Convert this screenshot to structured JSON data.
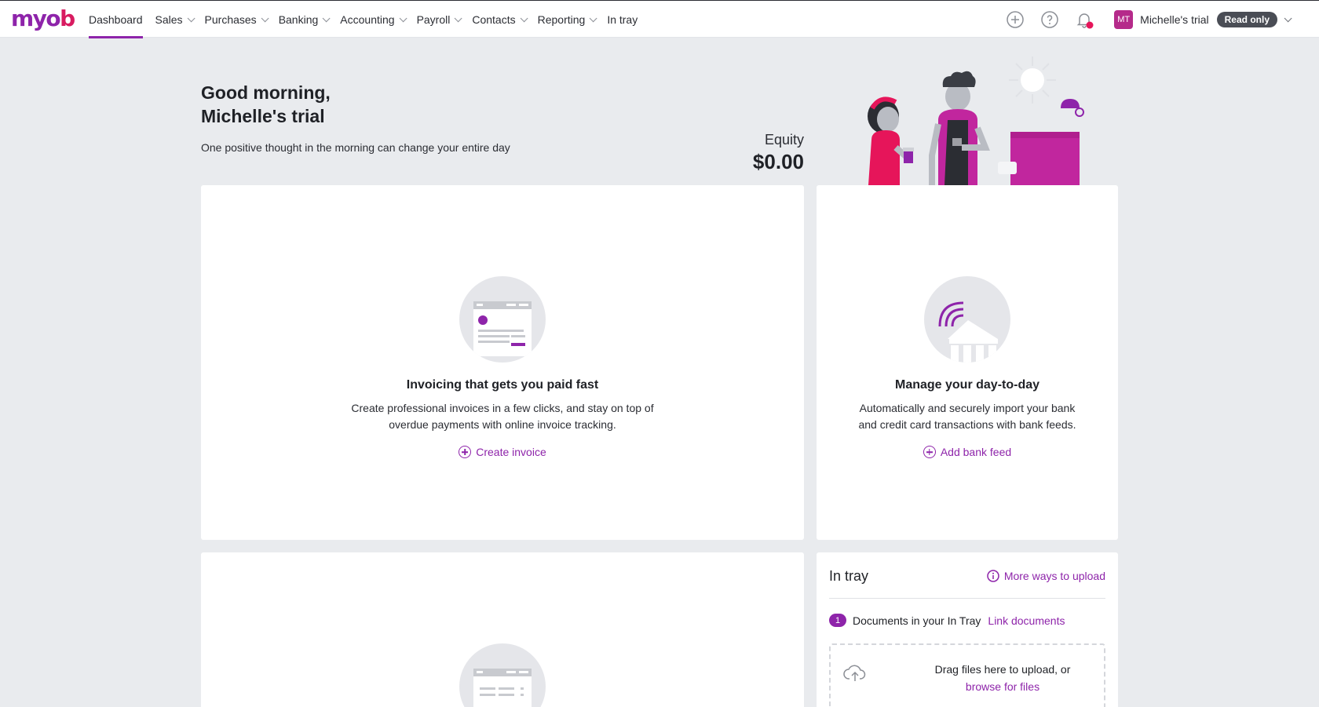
{
  "brand": {
    "logo_main": "myo",
    "logo_accent": "b"
  },
  "nav": {
    "items": [
      {
        "label": "Dashboard",
        "active": true,
        "dropdown": false
      },
      {
        "label": "Sales",
        "dropdown": true
      },
      {
        "label": "Purchases",
        "dropdown": true
      },
      {
        "label": "Banking",
        "dropdown": true
      },
      {
        "label": "Accounting",
        "dropdown": true
      },
      {
        "label": "Payroll",
        "dropdown": true
      },
      {
        "label": "Contacts",
        "dropdown": true
      },
      {
        "label": "Reporting",
        "dropdown": true
      },
      {
        "label": "In tray",
        "dropdown": false
      }
    ]
  },
  "header_tools": {
    "add_icon": "plus-circle-icon",
    "help_icon": "question-circle-icon",
    "notification_icon": "bell-icon",
    "avatar_initials": "MT",
    "business_name": "Michelle's trial",
    "access_badge": "Read only"
  },
  "greeting": {
    "line1": "Good morning,",
    "line2": "Michelle's trial",
    "quote": "One positive thought in the morning can change your entire day"
  },
  "equity": {
    "label": "Equity",
    "value": "$0.00"
  },
  "cards": {
    "invoicing": {
      "title": "Invoicing that gets you paid fast",
      "body": "Create professional invoices in a few clicks, and stay on top of overdue payments with online invoice tracking.",
      "action": "Create invoice"
    },
    "banking": {
      "title": "Manage your day-to-day",
      "body": "Automatically and securely import your bank and credit card transactions with bank feeds.",
      "action": "Add bank feed"
    }
  },
  "intray": {
    "title": "In tray",
    "more_link": "More ways to upload",
    "doc_count": "1",
    "doc_label": "Documents in your In Tray",
    "link_docs": "Link documents",
    "drop_text": "Drag files here to upload, or",
    "browse": "browse for files"
  },
  "colors": {
    "accent": "#8e24aa",
    "brand_pink": "#d81b60",
    "background": "#e9ebee"
  }
}
